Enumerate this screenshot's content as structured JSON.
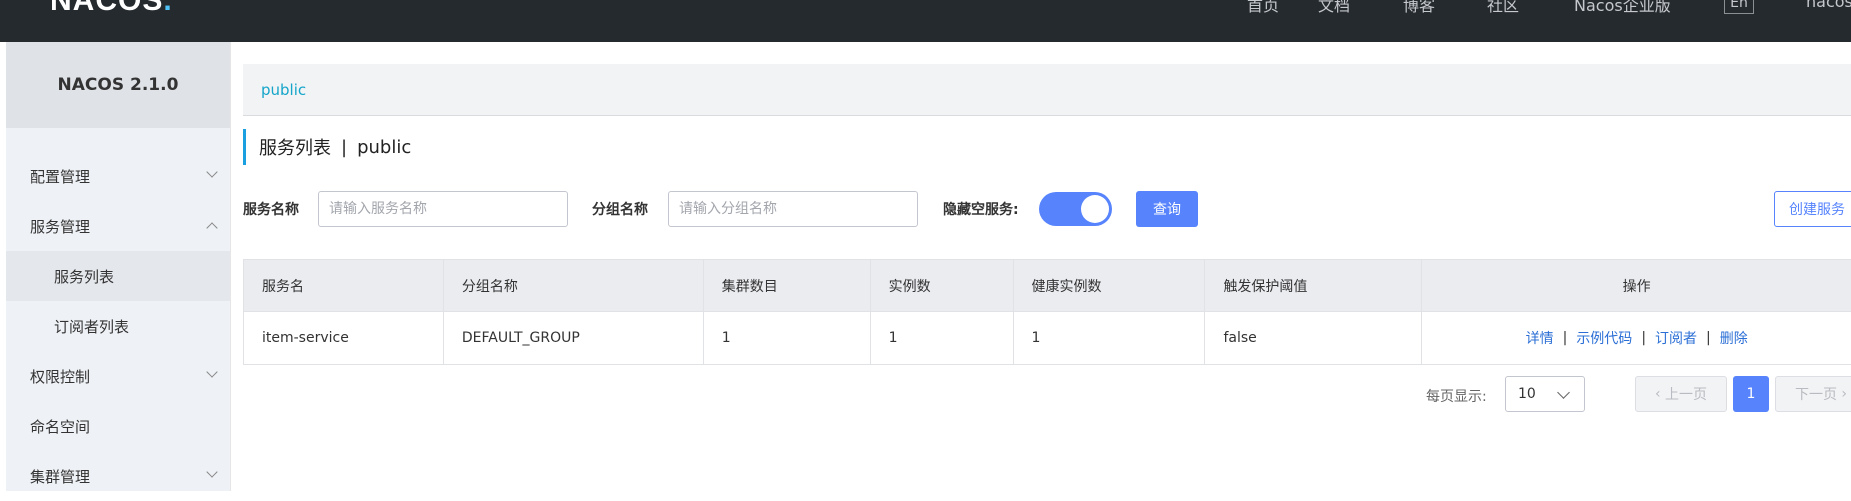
{
  "header": {
    "logo": "NACOS.",
    "nav": [
      "首页",
      "文档",
      "博客",
      "社区",
      "Nacos企业版"
    ],
    "lang_button": "En",
    "user": "nacos"
  },
  "sidebar": {
    "brand": "NACOS 2.1.0",
    "items": [
      {
        "label": "配置管理",
        "chevron": "down"
      },
      {
        "label": "服务管理",
        "chevron": "up"
      },
      {
        "label": "服务列表",
        "sub": true,
        "active": true
      },
      {
        "label": "订阅者列表",
        "sub": true
      },
      {
        "label": "权限控制",
        "chevron": "down"
      },
      {
        "label": "命名空间"
      },
      {
        "label": "集群管理",
        "chevron": "down"
      }
    ]
  },
  "namespace_bar": {
    "link": "public"
  },
  "title": {
    "main": "服务列表",
    "sep": "|",
    "namespace": "public"
  },
  "filters": {
    "service_label": "服务名称",
    "service_placeholder": "请输入服务名称",
    "group_label": "分组名称",
    "group_placeholder": "请输入分组名称",
    "hide_empty_label": "隐藏空服务:",
    "hide_empty_on": true,
    "query_button": "查询",
    "create_button": "创建服务"
  },
  "table": {
    "columns": [
      "服务名",
      "分组名称",
      "集群数目",
      "实例数",
      "健康实例数",
      "触发保护阈值",
      "操作"
    ],
    "rows": [
      {
        "cells": [
          "item-service",
          "DEFAULT_GROUP",
          "1",
          "1",
          "1",
          "false"
        ],
        "actions": [
          "详情",
          "示例代码",
          "订阅者",
          "删除"
        ]
      }
    ],
    "action_sep": "|"
  },
  "pagination": {
    "page_size_label": "每页显示:",
    "page_size": "10",
    "prev": "上一页",
    "current_page": "1",
    "next": "下一页"
  },
  "colors": {
    "header_bg": "#252a2f",
    "sidebar_bg": "#eef1f5",
    "primary": "#5784fd",
    "link": "#2b6fd6",
    "namespace_link": "#14a5c9"
  }
}
